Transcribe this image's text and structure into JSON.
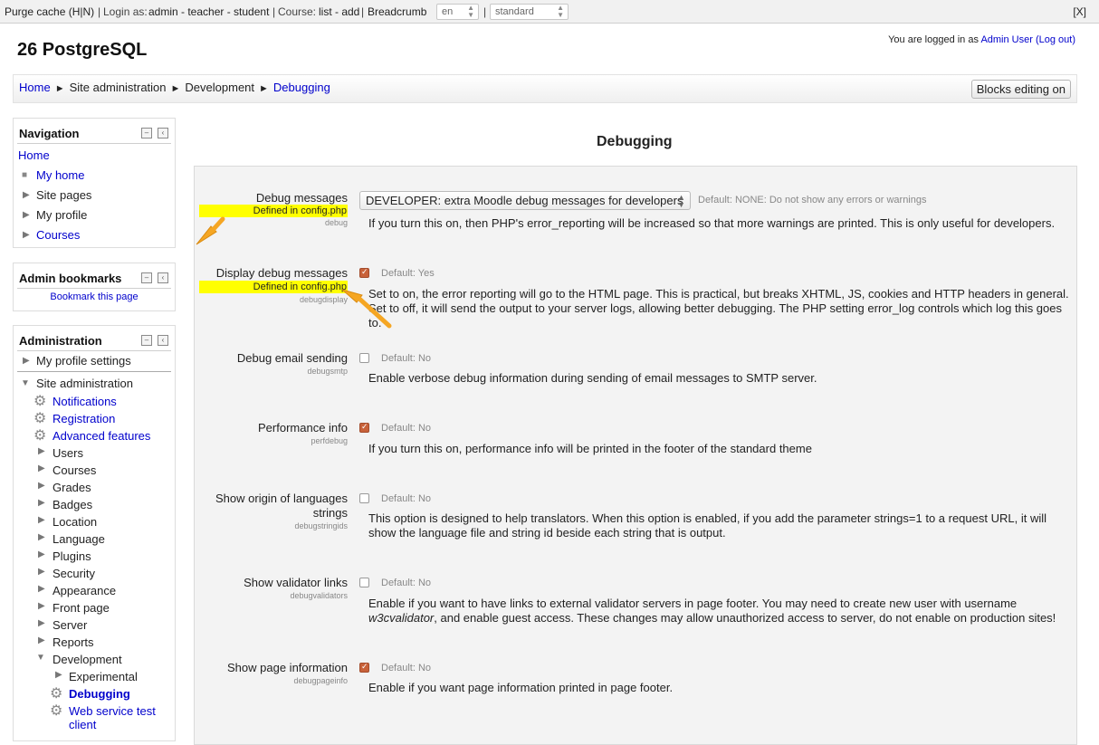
{
  "devbar": {
    "purge": "Purge cache (H|N)",
    "sep": "|",
    "login_as": "Login as:",
    "login_users": "admin - teacher - student",
    "course": "Course:",
    "course_links": "list - add",
    "breadcrumb": "Breadcrumb",
    "lang_value": "en",
    "theme_value": "standard",
    "close": "[X]"
  },
  "header": {
    "site_title": "26 PostgreSQL",
    "logged_in_prefix": "You are logged in as",
    "user_name": "Admin User",
    "logout": "(Log out)"
  },
  "breadcrumb": {
    "items": [
      "Home",
      "Site administration",
      "Development",
      "Debugging"
    ],
    "separator": "►"
  },
  "blocks_button": "Blocks editing on",
  "navigation": {
    "title": "Navigation",
    "items": [
      "Home",
      "My home",
      "Site pages",
      "My profile",
      "Courses"
    ]
  },
  "admin_bookmarks": {
    "title": "Admin bookmarks",
    "link": "Bookmark this page"
  },
  "administration": {
    "title": "Administration",
    "my_profile_settings": "My profile settings",
    "site_admin": "Site administration",
    "items": [
      "Notifications",
      "Registration",
      "Advanced features",
      "Users",
      "Courses",
      "Grades",
      "Badges",
      "Location",
      "Language",
      "Plugins",
      "Security",
      "Appearance",
      "Front page",
      "Server",
      "Reports",
      "Development"
    ],
    "dev_items": [
      "Experimental",
      "Debugging",
      "Web service test",
      "client"
    ]
  },
  "page": {
    "heading": "Debugging",
    "defined_in_config": "Defined in config.php"
  },
  "settings": [
    {
      "label": "Debug messages",
      "key": "debug",
      "value": "DEVELOPER: extra Moodle debug messages for developers",
      "default": "Default: NONE: Do not show any errors or warnings",
      "desc": "If you turn this on, then PHP's error_reporting will be increased so that more warnings are printed. This is only useful for developers."
    },
    {
      "label": "Display debug messages",
      "key": "debugdisplay",
      "checked": true,
      "default": "Default: Yes",
      "desc": "Set to on, the error reporting will go to the HTML page. This is practical, but breaks XHTML, JS, cookies and HTTP headers in general. Set to off, it will send the output to your server logs, allowing better debugging. The PHP setting error_log controls which log this goes to."
    },
    {
      "label": "Debug email sending",
      "key": "debugsmtp",
      "checked": false,
      "default": "Default: No",
      "desc": "Enable verbose debug information during sending of email messages to SMTP server."
    },
    {
      "label": "Performance info",
      "key": "perfdebug",
      "checked": true,
      "default": "Default: No",
      "desc": "If you turn this on, performance info will be printed in the footer of the standard theme"
    },
    {
      "label": "Show origin of languages strings",
      "label_line1": "Show origin of languages",
      "label_line2": "strings",
      "key": "debugstringids",
      "checked": false,
      "default": "Default: No",
      "desc": "This option is designed to help translators. When this option is enabled, if you add the parameter strings=1 to a request URL, it will show the language file and string id beside each string that is output."
    },
    {
      "label": "Show validator links",
      "key": "debugvalidators",
      "checked": false,
      "default": "Default: No",
      "desc_part1": "Enable if you want to have links to external validator servers in page footer. You may need to create new user with username",
      "desc_italic": "w3cvalidator",
      "desc_part2": ", and enable guest access. These changes may allow unauthorized access to server, do not enable on production sites!"
    },
    {
      "label": "Show page information",
      "key": "debugpageinfo",
      "checked": true,
      "default": "Default: No",
      "desc": "Enable if you want page information printed in page footer."
    }
  ],
  "colors": {
    "link": "#0000cc",
    "highlight": "#ffff00",
    "annotation_arrow": "#f5a623",
    "checkbox_checked": "#c8623a"
  }
}
